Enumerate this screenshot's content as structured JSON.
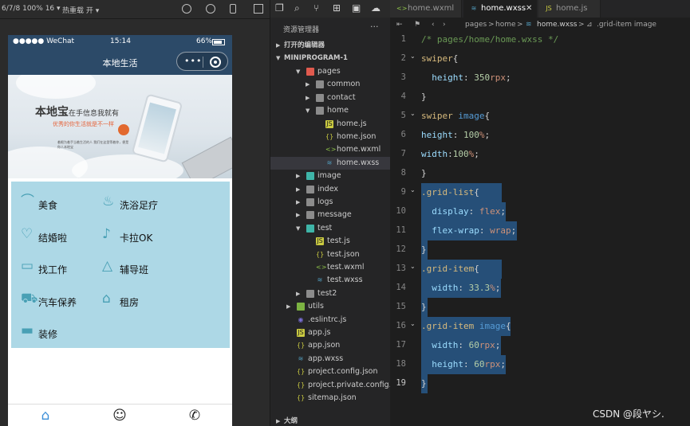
{
  "simulator": {
    "toolbar_left": "6/7/8 100% 16 ▾",
    "toolbar_hot": "热重载 开 ▾",
    "status_carrier": "●●●●● WeChat",
    "status_time": "15:14",
    "status_battery": "66%",
    "nav_title": "本地生活",
    "capsule_dots": "•••",
    "banner": {
      "headline": "本地宝",
      "headline_small": "在手信息我就有",
      "tagline": "优秀的你生活就是不一样",
      "fine_print": "着眼为着手当着生活的人  我们在这里等着你，便是你人本地宝"
    },
    "grid_items": [
      {
        "label": "美食",
        "icon": "food-icon"
      },
      {
        "label": "洗浴足疗",
        "icon": "bath-icon"
      },
      {
        "label": "结婚啦",
        "icon": "wedding-icon"
      },
      {
        "label": "卡拉OK",
        "icon": "microphone-icon"
      },
      {
        "label": "找工作",
        "icon": "briefcase-icon"
      },
      {
        "label": "辅导班",
        "icon": "graduation-cap-icon"
      },
      {
        "label": "汽车保养",
        "icon": "car-icon"
      },
      {
        "label": "租房",
        "icon": "house-icon"
      },
      {
        "label": "装修",
        "icon": "paint-roller-icon"
      }
    ],
    "tabbar": [
      "home-icon",
      "messages-icon",
      "phone-icon"
    ]
  },
  "explorer": {
    "title": "资源管理器",
    "more": "···",
    "sections": {
      "open_editors": "打开的编辑器",
      "project": "MINIPROGRAM-1",
      "outline": "大纲"
    },
    "tree": [
      {
        "name": "pages",
        "kind": "folder-red",
        "open": true,
        "depth": 1
      },
      {
        "name": "common",
        "kind": "folder",
        "open": false,
        "depth": 2
      },
      {
        "name": "contact",
        "kind": "folder",
        "open": false,
        "depth": 2
      },
      {
        "name": "home",
        "kind": "folder",
        "open": true,
        "depth": 2
      },
      {
        "name": "home.js",
        "kind": "js",
        "depth": 3
      },
      {
        "name": "home.json",
        "kind": "json",
        "depth": 3
      },
      {
        "name": "home.wxml",
        "kind": "wxml",
        "depth": 3
      },
      {
        "name": "home.wxss",
        "kind": "wxss",
        "depth": 3,
        "selected": true
      },
      {
        "name": "image",
        "kind": "folder-teal",
        "open": false,
        "depth": 1
      },
      {
        "name": "index",
        "kind": "folder",
        "open": false,
        "depth": 1
      },
      {
        "name": "logs",
        "kind": "folder",
        "open": false,
        "depth": 1
      },
      {
        "name": "message",
        "kind": "folder",
        "open": false,
        "depth": 1
      },
      {
        "name": "test",
        "kind": "folder-teal",
        "open": true,
        "depth": 1
      },
      {
        "name": "test.js",
        "kind": "js",
        "depth": 2
      },
      {
        "name": "test.json",
        "kind": "json",
        "depth": 2
      },
      {
        "name": "test.wxml",
        "kind": "wxml",
        "depth": 2
      },
      {
        "name": "test.wxss",
        "kind": "wxss",
        "depth": 2
      },
      {
        "name": "test2",
        "kind": "folder",
        "open": false,
        "depth": 1
      },
      {
        "name": "utils",
        "kind": "folder-green",
        "open": false,
        "depth": 0
      },
      {
        "name": ".eslintrc.js",
        "kind": "eslint",
        "depth": 0
      },
      {
        "name": "app.js",
        "kind": "js",
        "depth": 0
      },
      {
        "name": "app.json",
        "kind": "json",
        "depth": 0
      },
      {
        "name": "app.wxss",
        "kind": "wxss",
        "depth": 0
      },
      {
        "name": "project.config.json",
        "kind": "json",
        "depth": 0
      },
      {
        "name": "project.private.config.js...",
        "kind": "json",
        "depth": 0
      },
      {
        "name": "sitemap.json",
        "kind": "json",
        "depth": 0
      }
    ]
  },
  "editor": {
    "tabs": [
      {
        "name": "home.wxml",
        "kind": "wxml",
        "active": false
      },
      {
        "name": "home.wxss",
        "kind": "wxss",
        "active": true,
        "close": "✕"
      },
      {
        "name": "home.js",
        "kind": "js",
        "active": false
      }
    ],
    "breadcrumb": [
      "pages",
      "home",
      "home.wxss",
      ".grid-item image"
    ],
    "lines": [
      {
        "n": "1",
        "tokens": [
          [
            "c-com",
            "/* pages/home/home.wxss */"
          ]
        ]
      },
      {
        "n": "2",
        "fold": true,
        "tokens": [
          [
            "c-sel",
            "swiper"
          ],
          [
            "c-pl",
            "{"
          ]
        ]
      },
      {
        "n": "3",
        "tokens": [
          [
            "c-pl",
            "  "
          ],
          [
            "c-prop",
            "height"
          ],
          [
            "c-pl",
            ": "
          ],
          [
            "c-num",
            "350"
          ],
          [
            "c-val",
            "rpx"
          ],
          [
            "c-pl",
            ";"
          ]
        ]
      },
      {
        "n": "4",
        "tokens": [
          [
            "c-pl",
            "}"
          ]
        ]
      },
      {
        "n": "5",
        "fold": true,
        "tokens": [
          [
            "c-sel",
            "swiper "
          ],
          [
            "c-tag",
            "image"
          ],
          [
            "c-pl",
            "{"
          ]
        ]
      },
      {
        "n": "6",
        "tokens": [
          [
            "c-prop",
            "height"
          ],
          [
            "c-pl",
            ": "
          ],
          [
            "c-num",
            "100"
          ],
          [
            "c-val",
            "%"
          ],
          [
            "c-pl",
            ";"
          ]
        ]
      },
      {
        "n": "7",
        "tokens": [
          [
            "c-prop",
            "width"
          ],
          [
            "c-pl",
            ":"
          ],
          [
            "c-num",
            "100"
          ],
          [
            "c-val",
            "%"
          ],
          [
            "c-pl",
            ";"
          ]
        ]
      },
      {
        "n": "8",
        "tokens": [
          [
            "c-pl",
            "}"
          ]
        ]
      },
      {
        "n": "9",
        "fold": true,
        "hl": 101,
        "tokens": [
          [
            "c-sel",
            ".grid-list"
          ],
          [
            "c-pl",
            "{"
          ]
        ]
      },
      {
        "n": "10",
        "hl": 106,
        "tokens": [
          [
            "c-pl",
            "  "
          ],
          [
            "c-prop",
            "display"
          ],
          [
            "c-pl",
            ": "
          ],
          [
            "c-val",
            "flex"
          ],
          [
            "c-pl",
            ";"
          ]
        ]
      },
      {
        "n": "11",
        "hl": 120,
        "tokens": [
          [
            "c-pl",
            "  "
          ],
          [
            "c-prop",
            "flex-wrap"
          ],
          [
            "c-pl",
            ": "
          ],
          [
            "c-val",
            "wrap"
          ],
          [
            "c-pl",
            ";"
          ]
        ]
      },
      {
        "n": "12",
        "hl": 8,
        "tokens": [
          [
            "c-pl",
            "}"
          ]
        ]
      },
      {
        "n": "13",
        "fold": true,
        "hl": 101,
        "tokens": [
          [
            "c-sel",
            ".grid-item"
          ],
          [
            "c-pl",
            "{"
          ]
        ]
      },
      {
        "n": "14",
        "hl": 100,
        "tokens": [
          [
            "c-pl",
            "  "
          ],
          [
            "c-prop",
            "width"
          ],
          [
            "c-pl",
            ": "
          ],
          [
            "c-num",
            "33.3"
          ],
          [
            "c-val",
            "%"
          ],
          [
            "c-pl",
            ";"
          ]
        ]
      },
      {
        "n": "15",
        "hl": 8,
        "tokens": [
          [
            "c-pl",
            "}"
          ]
        ]
      },
      {
        "n": "16",
        "fold": true,
        "hl": 112,
        "tokens": [
          [
            "c-sel",
            ".grid-item "
          ],
          [
            "c-tag",
            "image"
          ],
          [
            "c-pl",
            "{"
          ]
        ]
      },
      {
        "n": "17",
        "hl": 100,
        "tokens": [
          [
            "c-pl",
            "  "
          ],
          [
            "c-prop",
            "width"
          ],
          [
            "c-pl",
            ": "
          ],
          [
            "c-num",
            "60"
          ],
          [
            "c-val",
            "rpx"
          ],
          [
            "c-pl",
            ";"
          ]
        ]
      },
      {
        "n": "18",
        "hl": 106,
        "tokens": [
          [
            "c-pl",
            "  "
          ],
          [
            "c-prop",
            "height"
          ],
          [
            "c-pl",
            ": "
          ],
          [
            "c-num",
            "60"
          ],
          [
            "c-val",
            "rpx"
          ],
          [
            "c-pl",
            ";"
          ]
        ]
      },
      {
        "n": "19",
        "hl": 8,
        "cur": true,
        "tokens": [
          [
            "c-pl",
            "}"
          ]
        ]
      }
    ],
    "watermark": "CSDN @段ヤシ."
  },
  "colors": {
    "nav_bg": "#2c4a68",
    "grid_bg": "#add8e6",
    "selection": "#264f78",
    "editor_bg": "#1e1e1e"
  }
}
